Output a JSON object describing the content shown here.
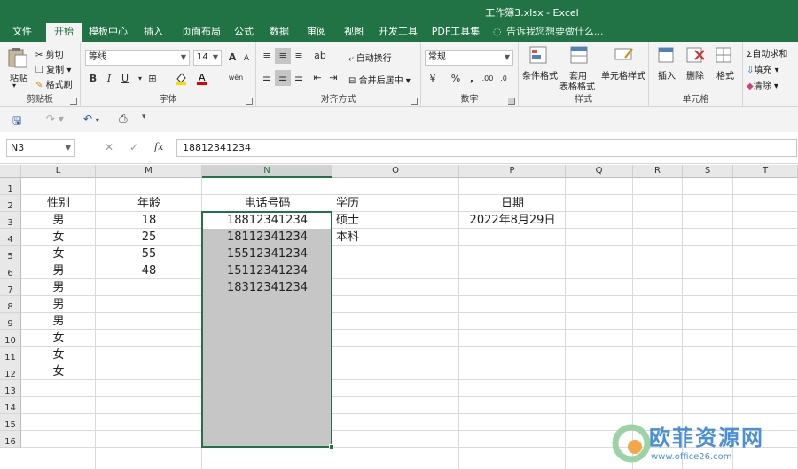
{
  "window": {
    "title": "工作簿3.xlsx - Excel"
  },
  "tabs": [
    "文件",
    "开始",
    "模板中心",
    "插入",
    "页面布局",
    "公式",
    "数据",
    "审阅",
    "视图",
    "开发工具",
    "PDF工具集"
  ],
  "active_tab": "开始",
  "tell_me": "告诉我您想要做什么...",
  "ribbon": {
    "clipboard": {
      "paste": "粘贴",
      "cut": "剪切",
      "copy": "复制",
      "format_painter": "格式刷",
      "label": "剪贴板"
    },
    "font": {
      "name": "等线",
      "size": "14",
      "bold": "B",
      "italic": "I",
      "underline": "U",
      "grow": "A",
      "shrink": "A",
      "wen": "wén",
      "label": "字体"
    },
    "alignment": {
      "wrap": "自动换行",
      "merge": "合并后居中",
      "label": "对齐方式"
    },
    "number": {
      "format": "常规",
      "percent": "%",
      "comma": ",",
      "label": "数字"
    },
    "styles": {
      "conditional": "条件格式",
      "table_line1": "套用",
      "table_line2": "表格格式",
      "cell_styles": "单元格样式",
      "label": "样式"
    },
    "cells": {
      "insert": "插入",
      "delete": "删除",
      "format": "格式",
      "label": "单元格"
    },
    "editing": {
      "autosum": "自动求和",
      "fill": "填充",
      "clear": "清除"
    }
  },
  "formula_bar": {
    "name_box": "N3",
    "cancel": "✕",
    "enter": "✓",
    "fx": "fx",
    "value": "18812341234"
  },
  "sheet": {
    "columns": [
      "L",
      "M",
      "N",
      "O",
      "P",
      "Q",
      "R",
      "S",
      "T"
    ],
    "selected_column": "N",
    "rows": [
      "1",
      "2",
      "3",
      "4",
      "5",
      "6",
      "7",
      "8",
      "9",
      "10",
      "11",
      "12",
      "13",
      "14",
      "15",
      "16"
    ],
    "headers": {
      "gender": "性别",
      "age": "年龄",
      "phone": "电话号码",
      "edu": "学历",
      "date": "日期"
    },
    "gender": [
      "男",
      "女",
      "女",
      "男",
      "男",
      "男",
      "男",
      "女",
      "女",
      "女"
    ],
    "age": [
      "18",
      "25",
      "55",
      "48"
    ],
    "phone": [
      "18812341234",
      "18112341234",
      "15512341234",
      "15112341234",
      "18312341234"
    ],
    "edu": [
      "硕士",
      "本科"
    ],
    "date": [
      "2022年8月29日"
    ]
  },
  "watermark": {
    "text": "欧菲资源网",
    "url": "www.office26.com"
  }
}
